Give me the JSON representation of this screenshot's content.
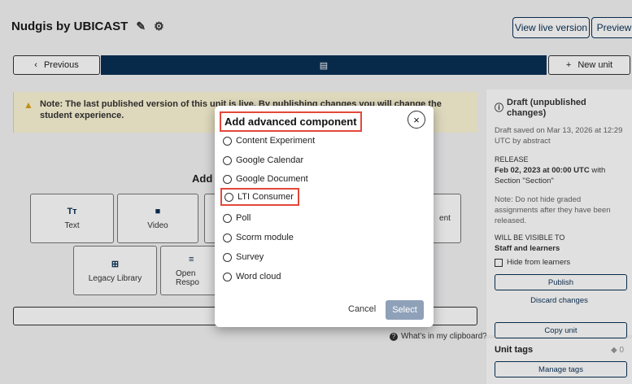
{
  "header": {
    "title": "Nudgis by UBICAST",
    "view_live": "View live version",
    "preview": "Preview"
  },
  "sequence": {
    "previous": "Previous",
    "new_unit": "New unit"
  },
  "warning": {
    "text": "Note: The last published version of this unit is live. By publishing changes you will change the student experience."
  },
  "add_component": {
    "heading": "Add",
    "tiles": [
      "Text",
      "Video",
      "Legacy Library",
      "Open Respo"
    ],
    "partial_right": "ent"
  },
  "clipboard": {
    "help": "What's in my clipboard?"
  },
  "sidebar": {
    "status_title": "Draft (unpublished changes)",
    "saved": "Draft saved on Mar 13, 2026 at 12:29 UTC by abstract",
    "release_label": "RELEASE",
    "release_date": "Feb 02, 2023 at 00:00 UTC",
    "release_rest": "with Section \"Section\"",
    "note": "Note: Do not hide graded assignments after they have been released.",
    "visible_label": "WILL BE VISIBLE TO",
    "visible_value": "Staff and learners",
    "hide_label": "Hide from learners",
    "publish": "Publish",
    "discard": "Discard changes",
    "copy_unit": "Copy unit"
  },
  "tags": {
    "title": "Unit tags",
    "count": "0",
    "manage": "Manage tags"
  },
  "modal": {
    "title": "Add advanced component",
    "options": [
      "Content Experiment",
      "Google Calendar",
      "Google Document",
      "LTI Consumer",
      "Poll",
      "Scorm module",
      "Survey",
      "Word cloud"
    ],
    "cancel": "Cancel",
    "select": "Select"
  }
}
